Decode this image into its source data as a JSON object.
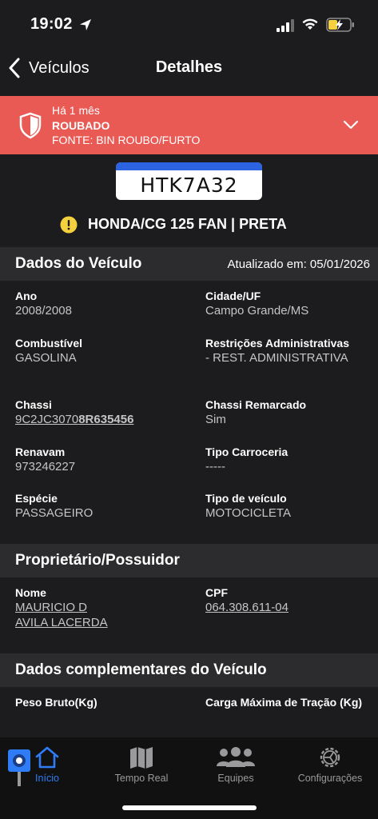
{
  "status_bar": {
    "time": "19:02"
  },
  "nav": {
    "back_label": "Veículos",
    "title": "Detalhes"
  },
  "alert": {
    "time": "Há 1 mês",
    "status": "ROUBADO",
    "source": "FONTE: BIN ROUBO/FURTO",
    "color": "#ea5a55"
  },
  "plate": {
    "number": "HTK7A32"
  },
  "vehicle": {
    "title": "HONDA/CG 125 FAN | PRETA"
  },
  "vehicle_section": {
    "title": "Dados do Veículo",
    "updated": "Atualizado em: 05/01/2026",
    "fields": {
      "ano": {
        "label": "Ano",
        "value": "2008/2008"
      },
      "cidade": {
        "label": "Cidade/UF",
        "value": "Campo Grande/MS"
      },
      "combustivel": {
        "label": "Combustível",
        "value": "GASOLINA"
      },
      "restricoes": {
        "label": "Restrições Administrativas",
        "value": "- REST. ADMINISTRATIVA"
      },
      "chassi": {
        "label": "Chassi",
        "value_prefix": "9C2JC3070",
        "value_bold": "8R635456"
      },
      "chassi_remarcado": {
        "label": "Chassi Remarcado",
        "value": "Sim"
      },
      "renavam": {
        "label": "Renavam",
        "value": "973246227"
      },
      "tipo_carroceria": {
        "label": "Tipo Carroceria",
        "value": "-----"
      },
      "especie": {
        "label": "Espécie",
        "value": "PASSAGEIRO"
      },
      "tipo_veiculo": {
        "label": "Tipo de veículo",
        "value": "MOTOCICLETA"
      }
    }
  },
  "owner_section": {
    "title": "Proprietário/Possuidor",
    "fields": {
      "nome": {
        "label": "Nome",
        "value_line1": "MAURICIO D",
        "value_line2": "AVILA LACERDA"
      },
      "cpf": {
        "label": "CPF",
        "value": "064.308.611-04"
      }
    }
  },
  "complementary_section": {
    "title": "Dados complementares do Veículo",
    "fields": {
      "peso": {
        "label": "Peso Bruto(Kg)"
      },
      "carga": {
        "label": "Carga Máxima de Tração (Kg)"
      }
    }
  },
  "tab_bar": {
    "tabs": [
      {
        "label": "Início",
        "icon": "home-icon",
        "active": true
      },
      {
        "label": "Tempo Real",
        "icon": "map-icon",
        "active": false
      },
      {
        "label": "Equipes",
        "icon": "people-icon",
        "active": false
      },
      {
        "label": "Configurações",
        "icon": "gear-icon",
        "active": false
      }
    ],
    "active_color": "#2f7df6"
  }
}
